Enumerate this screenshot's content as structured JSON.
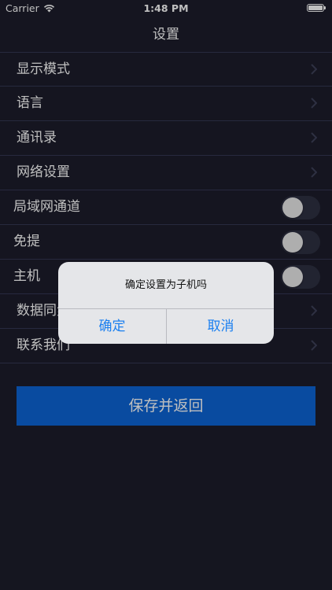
{
  "status_bar": {
    "carrier": "Carrier",
    "time": "1:48 PM"
  },
  "nav": {
    "title": "设置"
  },
  "settings": {
    "display_mode": "显示模式",
    "language": "语言",
    "contacts": "通讯录",
    "network": "网络设置",
    "lan_channel": {
      "label": "局域网通道",
      "on": false
    },
    "do_not_disturb": {
      "label": "免提",
      "on": false
    },
    "host": {
      "label": "主机",
      "on": false
    },
    "data_sync": "数据同步",
    "contact_us": "联系我们"
  },
  "save_button": "保存并返回",
  "alert": {
    "message": "确定设置为子机吗",
    "confirm": "确定",
    "cancel": "取消"
  }
}
